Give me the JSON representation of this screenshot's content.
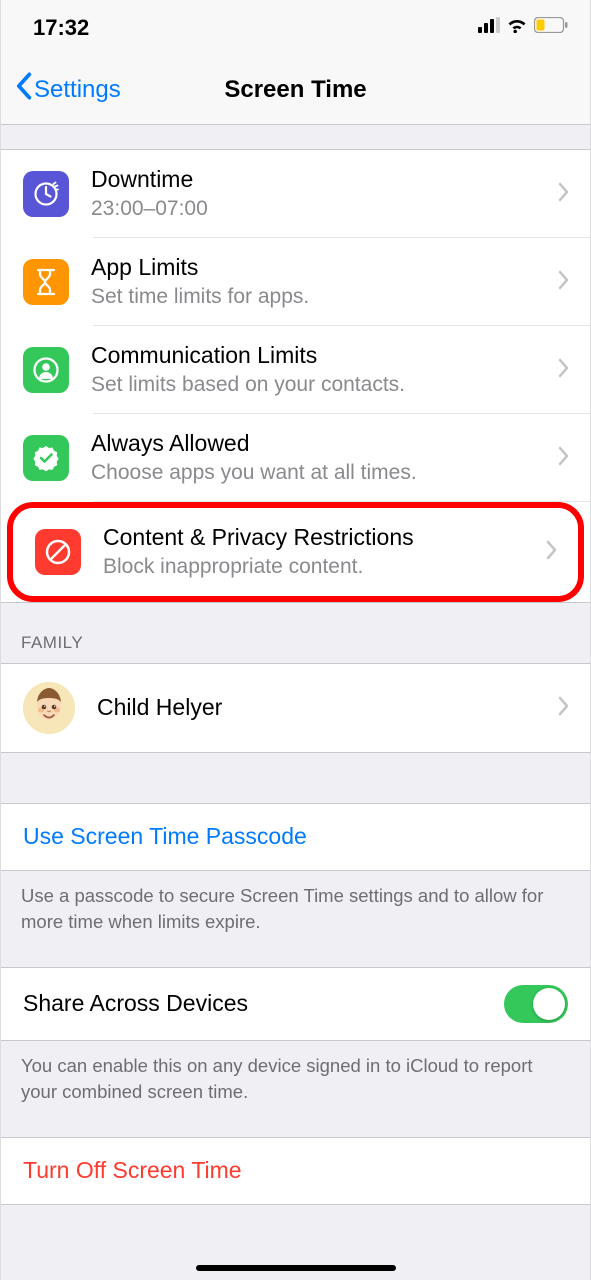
{
  "status": {
    "time": "17:32"
  },
  "nav": {
    "back": "Settings",
    "title": "Screen Time"
  },
  "items": {
    "downtime": {
      "title": "Downtime",
      "subtitle": "23:00–07:00"
    },
    "app_limits": {
      "title": "App Limits",
      "subtitle": "Set time limits for apps."
    },
    "comm_limits": {
      "title": "Communication Limits",
      "subtitle": "Set limits based on your contacts."
    },
    "always_allowed": {
      "title": "Always Allowed",
      "subtitle": "Choose apps you want at all times."
    },
    "content_privacy": {
      "title": "Content & Privacy Restrictions",
      "subtitle": "Block inappropriate content."
    }
  },
  "family": {
    "header": "FAMILY",
    "child": "Child Helyer"
  },
  "passcode": {
    "label": "Use Screen Time Passcode",
    "footer": "Use a passcode to secure Screen Time settings and to allow for more time when limits expire."
  },
  "share": {
    "label": "Share Across Devices",
    "footer": "You can enable this on any device signed in to iCloud to report your combined screen time."
  },
  "turn_off": {
    "label": "Turn Off Screen Time"
  },
  "icons": {
    "downtime_bg": "#5856d6",
    "app_limits_bg": "#ff9500",
    "comm_limits_bg": "#34c759",
    "always_allowed_bg": "#34c759",
    "content_privacy_bg": "#ff3b30"
  }
}
